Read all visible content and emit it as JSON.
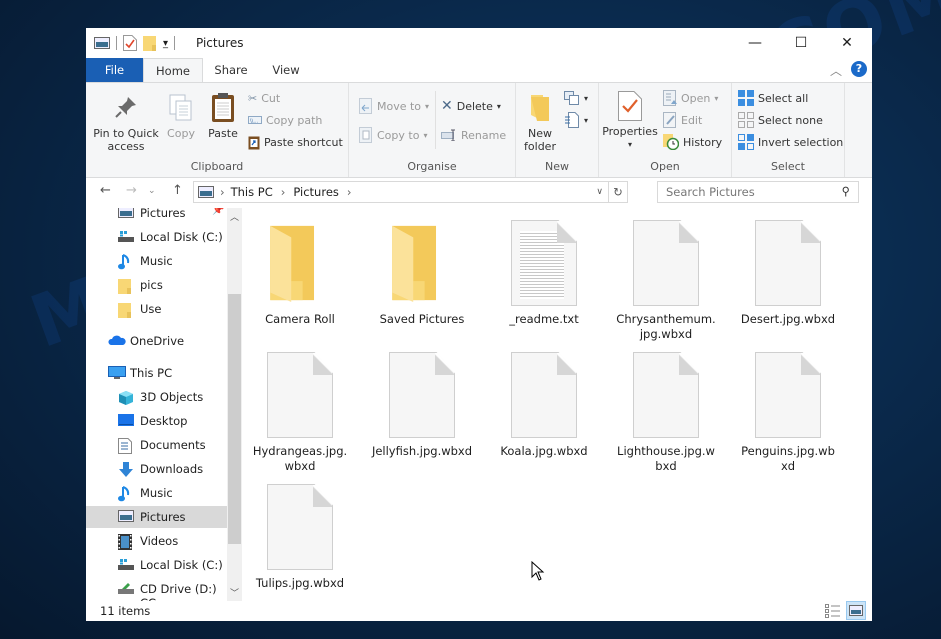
{
  "window": {
    "title": "Pictures",
    "controls": {
      "minimize": "—",
      "maximize": "☐",
      "close": "✕"
    }
  },
  "tabs": [
    {
      "label": "File"
    },
    {
      "label": "Home"
    },
    {
      "label": "Share"
    },
    {
      "label": "View"
    }
  ],
  "ribbon": {
    "clipboard": {
      "label": "Clipboard",
      "pin": "Pin to Quick access",
      "pin_line1": "Pin to Quick",
      "pin_line2": "access",
      "copy": "Copy",
      "paste": "Paste",
      "cut": "Cut",
      "copy_path": "Copy path",
      "paste_shortcut": "Paste shortcut"
    },
    "organise": {
      "label": "Organise",
      "move_to": "Move to",
      "copy_to": "Copy to",
      "delete": "Delete",
      "rename": "Rename"
    },
    "new": {
      "label": "New",
      "new_folder_line1": "New",
      "new_folder_line2": "folder"
    },
    "open": {
      "label": "Open",
      "properties": "Properties",
      "open": "Open",
      "edit": "Edit",
      "history": "History"
    },
    "select": {
      "label": "Select",
      "select_all": "Select all",
      "select_none": "Select none",
      "invert": "Invert selection"
    }
  },
  "address": {
    "crumbs": [
      "This PC",
      "Pictures"
    ],
    "search_placeholder": "Search Pictures"
  },
  "sidebar": {
    "items": [
      {
        "label": "Pictures",
        "icon": "pictures-icon",
        "pinned": true
      },
      {
        "label": "Local Disk (C:)",
        "icon": "drive-icon"
      },
      {
        "label": "Music",
        "icon": "music-icon"
      },
      {
        "label": "pics",
        "icon": "folder-icon"
      },
      {
        "label": "Use",
        "icon": "folder-icon"
      },
      {
        "label": "OneDrive",
        "icon": "onedrive-icon"
      },
      {
        "label": "This PC",
        "icon": "computer-icon"
      },
      {
        "label": "3D Objects",
        "icon": "3d-objects-icon"
      },
      {
        "label": "Desktop",
        "icon": "desktop-icon"
      },
      {
        "label": "Documents",
        "icon": "documents-icon"
      },
      {
        "label": "Downloads",
        "icon": "downloads-icon"
      },
      {
        "label": "Music",
        "icon": "music-icon"
      },
      {
        "label": "Pictures",
        "icon": "pictures-icon",
        "selected": true
      },
      {
        "label": "Videos",
        "icon": "videos-icon"
      },
      {
        "label": "Local Disk (C:)",
        "icon": "drive-icon"
      },
      {
        "label": "CD Drive (D:) CC",
        "icon": "cd-drive-icon"
      }
    ]
  },
  "files": [
    {
      "name": "Camera Roll",
      "type": "folder"
    },
    {
      "name": "Saved Pictures",
      "type": "folder"
    },
    {
      "name": "_readme.txt",
      "type": "text"
    },
    {
      "name": "Chrysanthemum.jpg.wbxd",
      "line1": "Chrysanthemum.",
      "line2": "jpg.wbxd",
      "type": "file"
    },
    {
      "name": "Desert.jpg.wbxd",
      "type": "file"
    },
    {
      "name": "Hydrangeas.jpg.wbxd",
      "line1": "Hydrangeas.jpg.",
      "line2": "wbxd",
      "type": "file"
    },
    {
      "name": "Jellyfish.jpg.wbxd",
      "type": "file"
    },
    {
      "name": "Koala.jpg.wbxd",
      "type": "file"
    },
    {
      "name": "Lighthouse.jpg.wbxd",
      "line1": "Lighthouse.jpg.w",
      "line2": "bxd",
      "type": "file"
    },
    {
      "name": "Penguins.jpg.wbxd",
      "line1": "Penguins.jpg.wb",
      "line2": "xd",
      "type": "file"
    },
    {
      "name": "Tulips.jpg.wbxd",
      "type": "file"
    }
  ],
  "status": {
    "count": "11 items"
  },
  "watermark": "MYANTISPYWARE.COM",
  "colors": {
    "accent": "#1a5fb4",
    "folder": "#f8d775",
    "selected": "#d9d9d9"
  }
}
